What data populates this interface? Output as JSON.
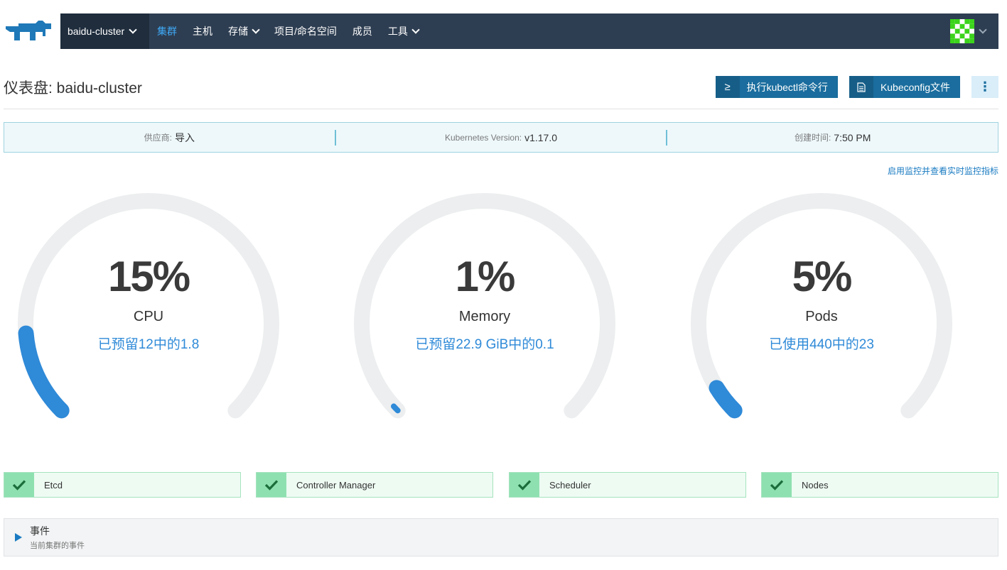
{
  "nav": {
    "cluster": "baidu-cluster",
    "items": [
      {
        "label": "集群",
        "active": true,
        "dropdown": false
      },
      {
        "label": "主机",
        "active": false,
        "dropdown": false
      },
      {
        "label": "存储",
        "active": false,
        "dropdown": true
      },
      {
        "label": "项目/命名空间",
        "active": false,
        "dropdown": false
      },
      {
        "label": "成员",
        "active": false,
        "dropdown": false
      },
      {
        "label": "工具",
        "active": false,
        "dropdown": true
      }
    ]
  },
  "header": {
    "title": "仪表盘: baidu-cluster",
    "kubectl_icon": "≥",
    "kubectl_label": "执行kubectl命令行",
    "kubeconfig_label": "Kubeconfig文件",
    "more_icon": "⋮"
  },
  "info": {
    "provider_key": "供应商:",
    "provider_val": "导入",
    "k8s_key": "Kubernetes Version:",
    "k8s_val": "v1.17.0",
    "created_key": "创建时间:",
    "created_val": "7:50 PM"
  },
  "monitor_link": "启用监控并查看实时监控指标",
  "gauges": [
    {
      "value": "15%",
      "label": "CPU",
      "sub": "已预留12中的1.8",
      "fraction": 0.15
    },
    {
      "value": "1%",
      "label": "Memory",
      "sub": "已预留22.9 GiB中的0.1",
      "fraction": 0.01
    },
    {
      "value": "5%",
      "label": "Pods",
      "sub": "已使用440中的23",
      "fraction": 0.05
    }
  ],
  "status": [
    {
      "label": "Etcd"
    },
    {
      "label": "Controller Manager"
    },
    {
      "label": "Scheduler"
    },
    {
      "label": "Nodes"
    }
  ],
  "events": {
    "title": "事件",
    "subtitle": "当前集群的事件"
  },
  "colors": {
    "navbar": "#2e3e52",
    "accent": "#2f8ad8",
    "gauge_track": "#eceeef",
    "ok": "#8fe0b0"
  }
}
